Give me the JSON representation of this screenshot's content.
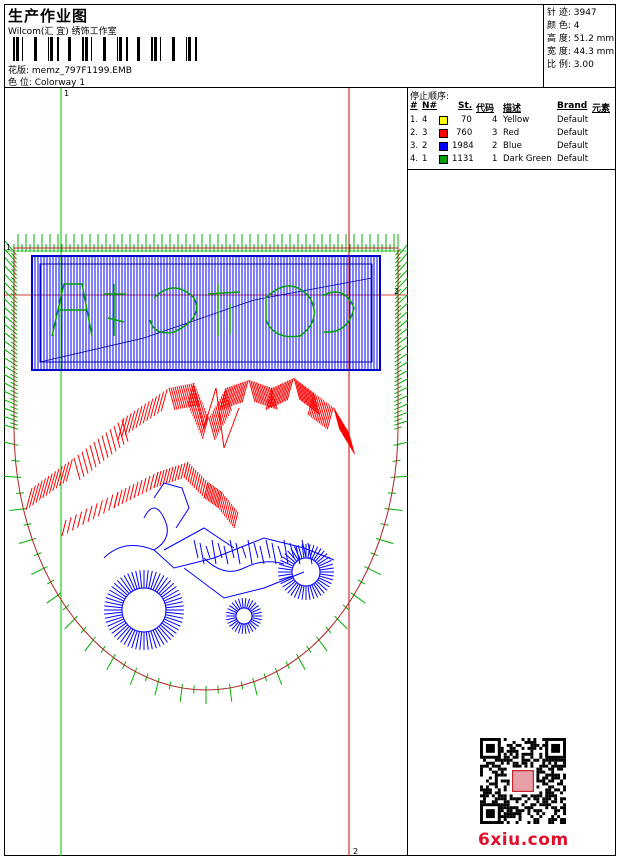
{
  "header": {
    "title": "生产作业图",
    "subtitle": "Wilcom(汇 宜) 绣饰工作室",
    "design_label": "花版: memz_797F1199.EMB",
    "colorway_label": "色 位:  Colorway 1"
  },
  "stats": {
    "stitches": "针 迹: 3947",
    "colors": "颜 色: 4",
    "height": "高 度: 51.2 mm",
    "width": "宽 度: 44.3 mm",
    "scale": "比 例: 3.00"
  },
  "stop_sequence": {
    "label": "停止顺序:",
    "headers": [
      "#",
      "N#",
      "St.",
      "代码",
      "描述",
      "Brand",
      "元素"
    ],
    "rows": [
      {
        "index": "1.",
        "needle": "4",
        "color": "#ffff00",
        "stitches": "70",
        "code": "4",
        "desc": "Yellow",
        "brand": "Default"
      },
      {
        "index": "2.",
        "needle": "3",
        "color": "#ff0000",
        "stitches": "760",
        "code": "3",
        "desc": "Red",
        "brand": "Default"
      },
      {
        "index": "3.",
        "needle": "2",
        "color": "#0000ff",
        "stitches": "1984",
        "code": "2",
        "desc": "Blue",
        "brand": "Default"
      },
      {
        "index": "4.",
        "needle": "1",
        "color": "#00a000",
        "stitches": "1131",
        "code": "1",
        "desc": "Dark Green",
        "brand": "Default"
      }
    ]
  },
  "guides": {
    "top_marker": "1",
    "bottom_marker": "2",
    "right_marker": "2",
    "left_marker": "1"
  },
  "watermark": {
    "site": "6xiu.com"
  },
  "colors": {
    "green": "#00a000",
    "red": "#ff0000",
    "blue": "#0000ff",
    "dark_red": "#b22222"
  }
}
